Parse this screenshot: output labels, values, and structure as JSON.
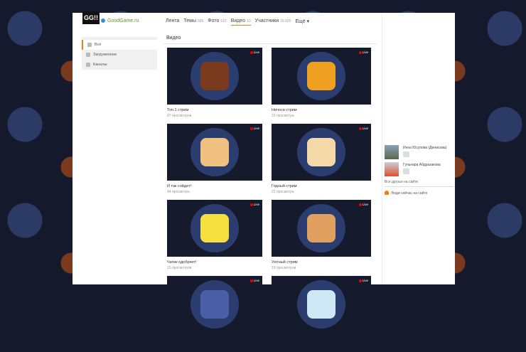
{
  "group": {
    "logo": "GG!!",
    "name": "GoodGame.ru"
  },
  "nav": [
    {
      "label": "Лента",
      "count": ""
    },
    {
      "label": "Темы",
      "count": "689"
    },
    {
      "label": "Фото",
      "count": "615"
    },
    {
      "label": "Видео",
      "count": "10"
    },
    {
      "label": "Участники",
      "count": "19 035"
    },
    {
      "label": "Ещё ▾",
      "count": ""
    }
  ],
  "sidebar": [
    "Всё",
    "Загруженное",
    "Каналы"
  ],
  "section_title": "Видео",
  "live_label": "Live",
  "videos": [
    {
      "title": "Топ.1 стрим",
      "views": "97 просмотров",
      "color": "#7a3a1e"
    },
    {
      "title": "Ничоси стрим",
      "views": "33 просмотра",
      "color": "#f0a020"
    },
    {
      "title": "И так сойдет!",
      "views": "44 просмотра",
      "color": "#f0c080"
    },
    {
      "title": "Годный стрим",
      "views": "22 просмотра",
      "color": "#f5d8a8"
    },
    {
      "title": "Чатик одобряет!",
      "views": "15 просмотров",
      "color": "#f5e040"
    },
    {
      "title": "Уютный стрим",
      "views": "19 просмотров",
      "color": "#e0a060"
    },
    {
      "title": "",
      "views": "",
      "color": "#4a5fa8"
    },
    {
      "title": "",
      "views": "",
      "color": "#cfe8f5"
    }
  ],
  "friends": [
    {
      "name": "Инна Юсупова (Денисова)"
    },
    {
      "name": "Гульнара Абдразакова"
    }
  ],
  "all_friends": "Все друзья на сайте",
  "people_online": "Люди сейчас на сайте"
}
